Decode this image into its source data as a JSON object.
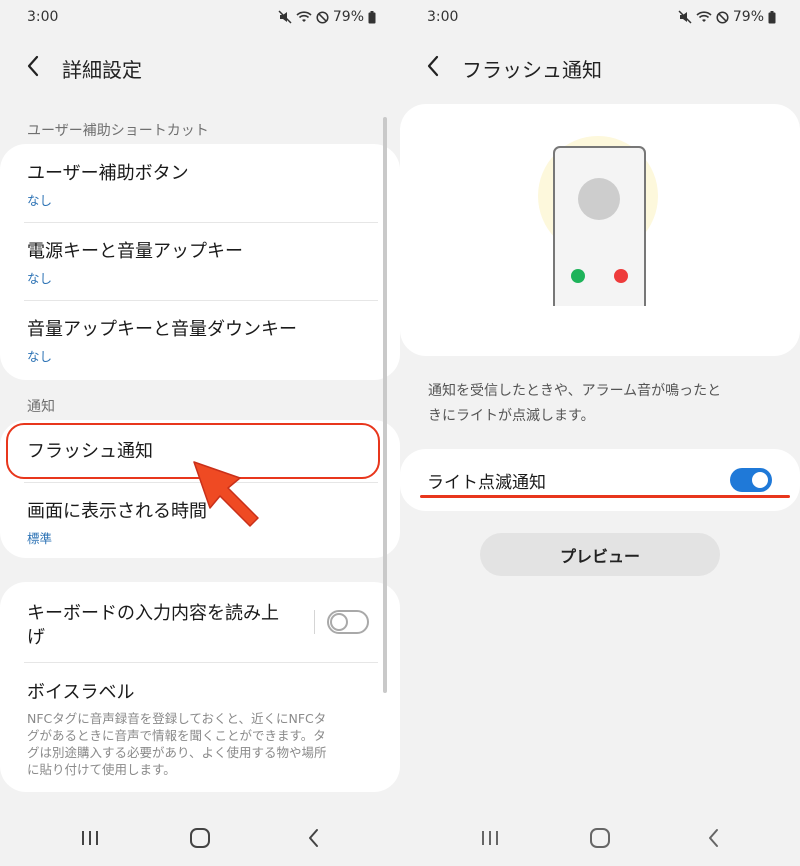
{
  "left": {
    "status": {
      "time": "3:00",
      "battery": "79%"
    },
    "app_bar": {
      "title": "詳細設定"
    },
    "sections": {
      "shortcut_label": "ユーザー補助ショートカット",
      "notification_label": "通知"
    },
    "rows": {
      "accessibility_button": {
        "title": "ユーザー補助ボタン",
        "value": "なし"
      },
      "power_volume_up": {
        "title": "電源キーと音量アップキー",
        "value": "なし"
      },
      "volume_up_down": {
        "title": "音量アップキーと音量ダウンキー",
        "value": "なし"
      },
      "flash_notification": {
        "title": "フラッシュ通知"
      },
      "screen_time": {
        "title": "画面に表示される時間",
        "value": "標準"
      },
      "keyboard_read": {
        "title_line1": "キーボードの入力内容を読み上",
        "title_line2": "げ",
        "toggle_state": "off"
      },
      "voice_label": {
        "title": "ボイスラベル",
        "desc_line1": "NFCタグに音声録音を登録しておくと、近くにNFCタ",
        "desc_line2": "グがあるときに音声で情報を聞くことができます。タ",
        "desc_line3": "グは別途購入する必要があり、よく使用する物や場所",
        "desc_line4": "に貼り付けて使用します。"
      }
    },
    "annotation": {
      "color": "#e8361c"
    }
  },
  "right": {
    "status": {
      "time": "3:00",
      "battery": "79%"
    },
    "app_bar": {
      "title": "フラッシュ通知"
    },
    "description_line1": "通知を受信したときや、アラーム音が鳴ったと",
    "description_line2": "きにライトが点滅します。",
    "light_flash": {
      "label": "ライト点滅通知",
      "toggle_state": "on"
    },
    "preview_button": "プレビュー",
    "illustration": {
      "dot_left_color": "#1eb35a",
      "dot_right_color": "#ee3b3b",
      "accent": "#1f79d8"
    }
  },
  "nav_icons": [
    "recent-apps-icon",
    "home-icon",
    "back-icon"
  ]
}
